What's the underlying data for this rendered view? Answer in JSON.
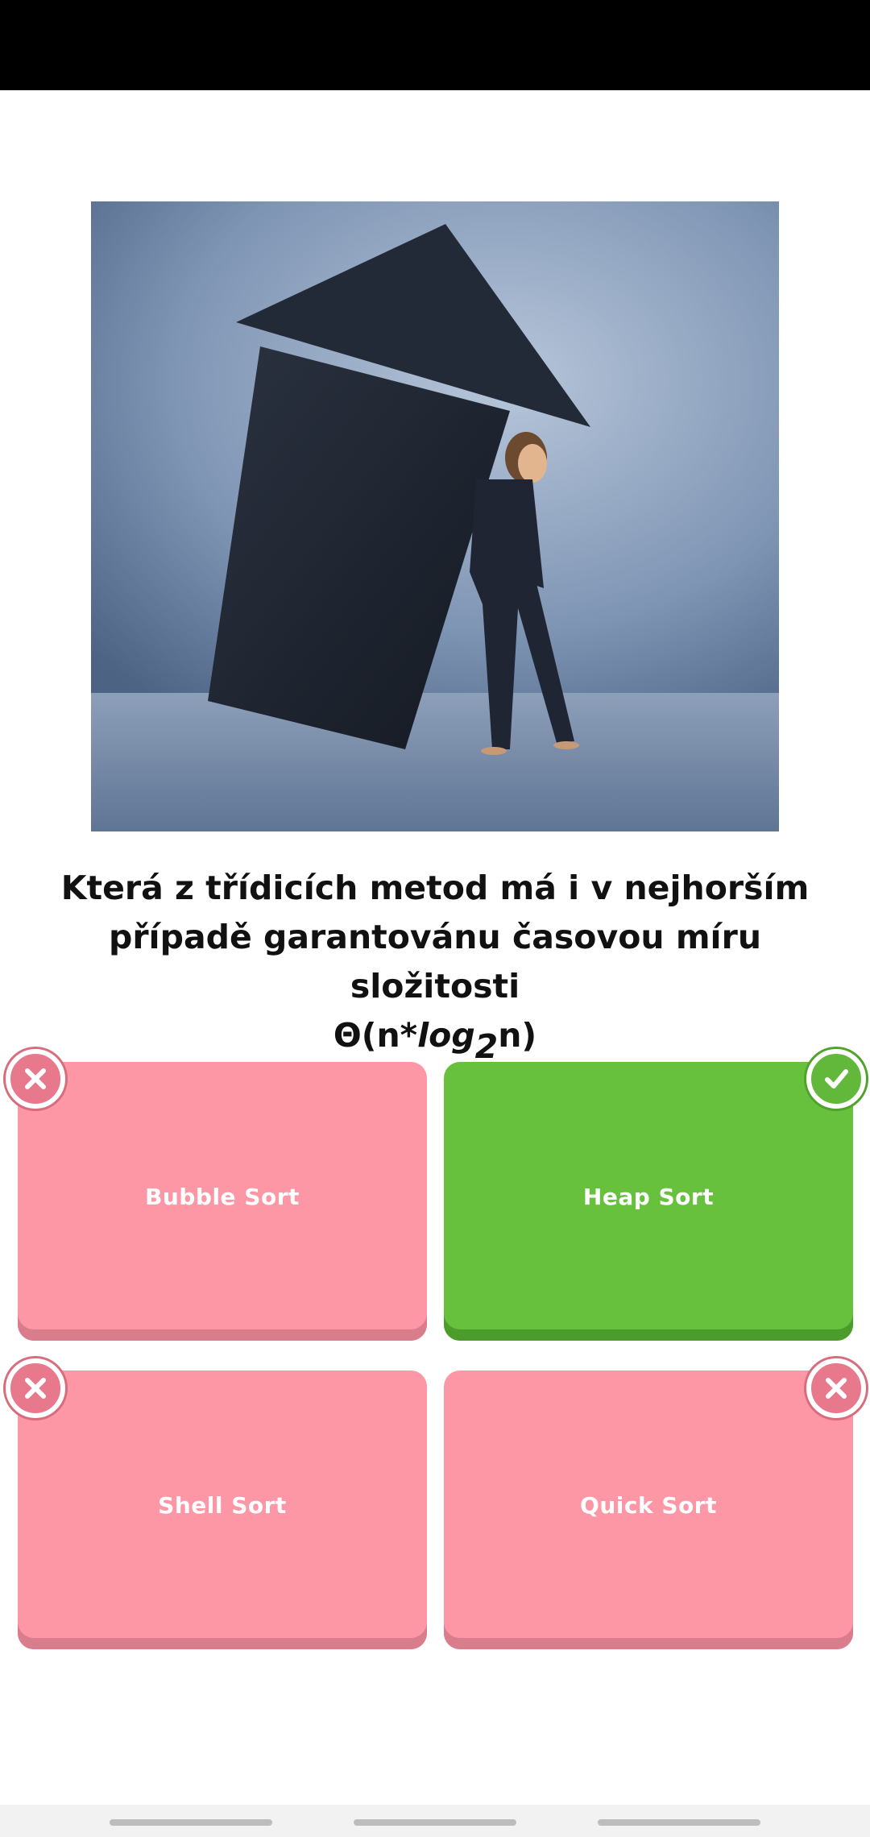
{
  "question": {
    "line1": "Která z třídicích metod má i v nejhorším",
    "line2": "případě garantovánu časovou míru složitosti",
    "formula_prefix": "Θ(n*",
    "formula_log": "log",
    "formula_sub": "2",
    "formula_suffix": "n)"
  },
  "hero_image": {
    "description_icon": "woman-pushing-arrow-image"
  },
  "answers": [
    {
      "label": "Bubble Sort",
      "state": "wrong",
      "badge_icon": "close-icon"
    },
    {
      "label": "Heap Sort",
      "state": "correct",
      "badge_icon": "check-icon"
    },
    {
      "label": "Shell Sort",
      "state": "wrong",
      "badge_icon": "close-icon"
    },
    {
      "label": "Quick Sort",
      "state": "wrong",
      "badge_icon": "close-icon"
    }
  ],
  "colors": {
    "wrong": "#fd97a6",
    "correct": "#67c13d"
  }
}
